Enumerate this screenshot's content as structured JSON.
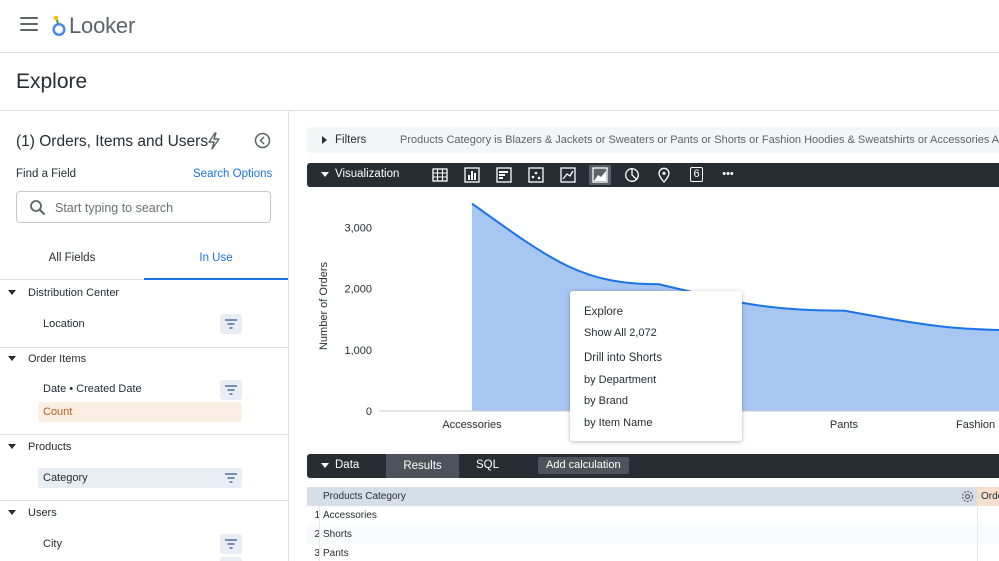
{
  "app": {
    "brand": "Looker",
    "page_title": "Explore"
  },
  "sidebar": {
    "explore_title": "(1) Orders, Items and Users",
    "find_label": "Find a Field",
    "search_options": "Search Options",
    "search_placeholder": "Start typing to search",
    "tabs": [
      "All Fields",
      "In Use"
    ],
    "groups": [
      {
        "label": "Distribution Center",
        "fields": [
          {
            "label": "Location",
            "type": "dimension",
            "selected": false,
            "filter": true
          }
        ]
      },
      {
        "label": "Order Items",
        "fields": [
          {
            "label": "Date • Created Date",
            "type": "dimension",
            "selected": false,
            "filter": true
          },
          {
            "label": "Count",
            "type": "measure",
            "selected": true,
            "filter": false
          }
        ]
      },
      {
        "label": "Products",
        "fields": [
          {
            "label": "Category",
            "type": "dimension",
            "selected": true,
            "filter": true
          }
        ]
      },
      {
        "label": "Users",
        "fields": [
          {
            "label": "City",
            "type": "dimension",
            "selected": false,
            "filter": true
          }
        ]
      }
    ]
  },
  "filters": {
    "label": "Filters",
    "expression": "Products Category is Blazers & Jackets or Sweaters or Pants or Shorts or Fashion Hoodies & Sweatshirts or Accessories AND"
  },
  "visualization": {
    "label": "Visualization",
    "icons": [
      "table-icon",
      "column-chart-icon",
      "bar-chart-icon",
      "scatter-icon",
      "line-chart-icon",
      "area-chart-icon",
      "pie-chart-icon",
      "map-pin-icon",
      "single-value-icon",
      "more-icon"
    ],
    "active_icon": "area-chart-icon",
    "single_value_glyph": "6",
    "more_glyph": "•••"
  },
  "chart_data": {
    "type": "area",
    "categories": [
      "Accessories",
      "Shorts",
      "Pants",
      "Fashion Hoodies & Sweatshirts"
    ],
    "visible_tick_labels": [
      "Accessories",
      "",
      "Pants",
      "Fashion H"
    ],
    "values": [
      3390,
      2072,
      1640,
      1320
    ],
    "ylabel": "Number of Orders",
    "yticks": [
      "0",
      "1,000",
      "2,000",
      "3,000"
    ],
    "ylim": [
      0,
      3400
    ],
    "color": "#1a73e8",
    "fill": "#a7c6f2"
  },
  "tooltip": {
    "header1": "Explore",
    "item1": "Show All 2,072",
    "header2": "Drill into Shorts",
    "items": [
      "by Department",
      "by Brand",
      "by Item Name"
    ]
  },
  "data": {
    "label": "Data",
    "tabs": [
      "Results",
      "SQL"
    ],
    "add_calculation": "Add calculation",
    "columns": [
      "Products Category",
      "Orde"
    ],
    "rows": [
      {
        "idx": "1",
        "value": "Accessories"
      },
      {
        "idx": "2",
        "value": "Shorts"
      },
      {
        "idx": "3",
        "value": "Pants"
      }
    ]
  }
}
